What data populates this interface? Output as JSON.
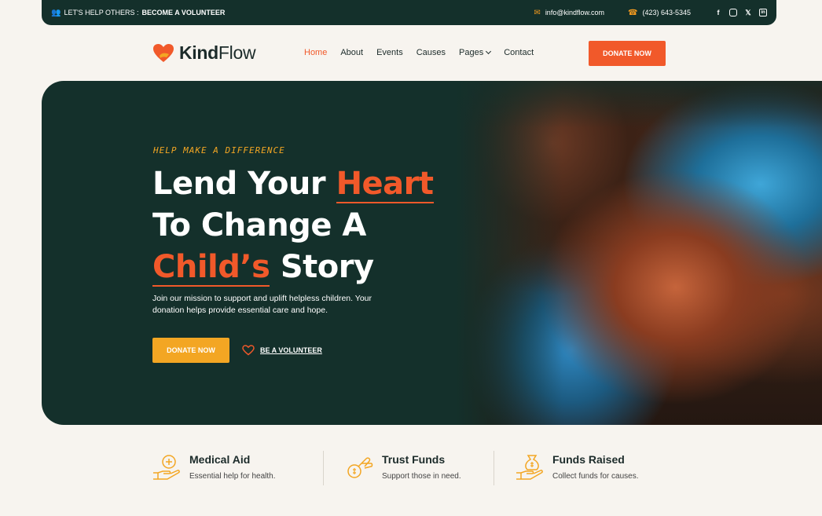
{
  "topbar": {
    "left_text": "LET'S HELP OTHERS :",
    "left_highlight": "BECOME A VOLUNTEER",
    "email": "info@kindflow.com",
    "phone": "(423) 643-5345",
    "socials": [
      "facebook-icon",
      "instagram-icon",
      "x-icon",
      "linkedin-icon"
    ]
  },
  "brand": {
    "name_bold": "Kind",
    "name_light": "Flow"
  },
  "nav": {
    "items": [
      {
        "label": "Home",
        "active": true
      },
      {
        "label": "About"
      },
      {
        "label": "Events"
      },
      {
        "label": "Causes"
      },
      {
        "label": "Pages"
      },
      {
        "label": "Contact"
      }
    ],
    "donate_label": "DONATE NOW"
  },
  "hero": {
    "kicker": "HELP MAKE A DIFFERENCE",
    "line1_a": "Lend Your ",
    "line1_b": "Heart",
    "line2": "To Change A",
    "line3_a": "Child’s",
    "line3_b": " Story",
    "description": "Join our mission to support and uplift helpless children. Your donation helps provide essential care and hope.",
    "donate_label": "DONATE NOW",
    "volunteer_label": "BE A VOLUNTEER"
  },
  "features": [
    {
      "title": "Medical Aid",
      "subtitle": "Essential help for health.",
      "icon": "medical-aid-icon"
    },
    {
      "title": "Trust Funds",
      "subtitle": "Support those in need.",
      "icon": "trust-funds-icon"
    },
    {
      "title": "Funds Raised",
      "subtitle": "Collect funds for causes.",
      "icon": "funds-raised-icon"
    }
  ],
  "colors": {
    "accent": "#f1592a",
    "secondary": "#f3a623",
    "dark": "#14302b",
    "background": "#f7f4ef"
  }
}
